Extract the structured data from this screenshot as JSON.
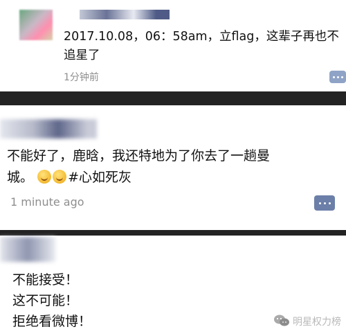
{
  "post1": {
    "text": "2017.10.08，06：58am，立flag，这辈子再也不追星了",
    "time": "1分钟前"
  },
  "post2": {
    "text_line1": "不能好了，鹿晗，我还特地为了你去了一趟曼",
    "text_line2_start": "城。",
    "text_line2_hashtag": "#心如死灰",
    "emoji_icon": "smiling-face-icon",
    "time": "1 minute ago"
  },
  "post3": {
    "lines": [
      "不能接受！",
      "这不可能！",
      "拒绝看微博！"
    ]
  },
  "watermark": {
    "icon": "wechat-icon",
    "text": "明星权力榜"
  },
  "colors": {
    "separator": "#232323",
    "comment_icon": "#6b7fa8",
    "meta_text": "#8e8e8e"
  }
}
